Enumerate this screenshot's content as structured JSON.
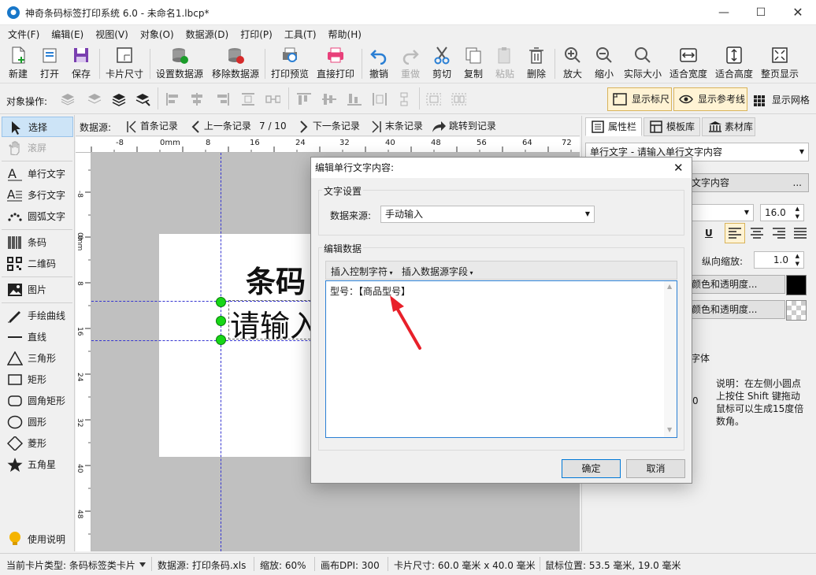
{
  "window": {
    "title": "神奇条码标签打印系统 6.0 - 未命名1.lbcp*"
  },
  "menu": [
    "文件(F)",
    "编辑(E)",
    "视图(V)",
    "对象(O)",
    "数据源(D)",
    "打印(P)",
    "工具(T)",
    "帮助(H)"
  ],
  "toolbar": {
    "new": "新建",
    "open": "打开",
    "save": "保存",
    "card_size": "卡片尺寸",
    "set_datasource": "设置数据源",
    "remove_datasource": "移除数据源",
    "print_preview": "打印预览",
    "direct_print": "直接打印",
    "undo": "撤销",
    "redo": "重做",
    "cut": "剪切",
    "copy": "复制",
    "paste": "粘贴",
    "delete": "删除",
    "zoom_in": "放大",
    "zoom_out": "缩小",
    "actual_size": "实际大小",
    "fit_width": "适合宽度",
    "fit_height": "适合高度",
    "fit_page": "整页显示"
  },
  "objbar": {
    "label": "对象操作:",
    "show_ruler": "显示标尺",
    "show_guides": "显示参考线",
    "show_grid": "显示网格"
  },
  "tools": {
    "select": "选择",
    "scroll": "滚屏",
    "single_text": "单行文字",
    "multi_text": "多行文字",
    "arc_text": "圆弧文字",
    "barcode": "条码",
    "qrcode": "二维码",
    "image": "图片",
    "freehand": "手绘曲线",
    "line": "直线",
    "triangle": "三角形",
    "rect": "矩形",
    "round_rect": "圆角矩形",
    "circle": "圆形",
    "diamond": "菱形",
    "star": "五角星",
    "help": "使用说明"
  },
  "nav": {
    "label": "数据源:",
    "first": "首条记录",
    "prev": "上一条记录",
    "position": "7 / 10",
    "next": "下一条记录",
    "last": "末条记录",
    "jump": "跳转到记录"
  },
  "ruler": {
    "h_marks": [
      "-8",
      "0mm",
      "8",
      "16",
      "24",
      "32",
      "40",
      "48",
      "56",
      "64",
      "72"
    ],
    "v_marks": [
      "-8",
      "0",
      "0mm",
      "8",
      "16",
      "24",
      "32",
      "40",
      "48"
    ]
  },
  "canvas": {
    "card_title": "条码",
    "card_text": "请输入"
  },
  "right_panel": {
    "tabs": [
      "属性栏",
      "模板库",
      "素材库"
    ],
    "selector": "单行文字 - 请输入单行文字内容",
    "content_btn": "文字内容",
    "font_size": "16.0",
    "underline": "U",
    "vscale_label": "纵向缩放:",
    "vscale_value": "1.0",
    "color_btn1": "颜色和透明度...",
    "color_btn2": "颜色和透明度...",
    "font_label": "字体",
    "tip": "说明：在左侧小圆点上按住 Shift 键拖动鼠标可以生成15度倍数角。",
    "zero": "0"
  },
  "dialog": {
    "title": "编辑单行文字内容:",
    "group1": "文字设置",
    "source_label": "数据来源:",
    "source_value": "手动输入",
    "group2": "编辑数据",
    "insert_ctrl": "插入控制字符",
    "insert_field": "插入数据源字段",
    "content": "型号：【商品型号】",
    "ok": "确定",
    "cancel": "取消"
  },
  "status": {
    "card_type": "当前卡片类型: 条码标签类卡片",
    "datasource": "数据源: 打印条码.xls",
    "zoom": "缩放: 60%",
    "dpi": "画布DPI: 300",
    "card_size": "卡片尺寸: 60.0 毫米 x 40.0 毫米",
    "mouse_pos": "鼠标位置: 53.5 毫米, 19.0 毫米"
  },
  "colors": {
    "accent": "#1877c9",
    "handle": "#17d617",
    "arrow": "#e8202a",
    "guide": "#3535d0"
  }
}
